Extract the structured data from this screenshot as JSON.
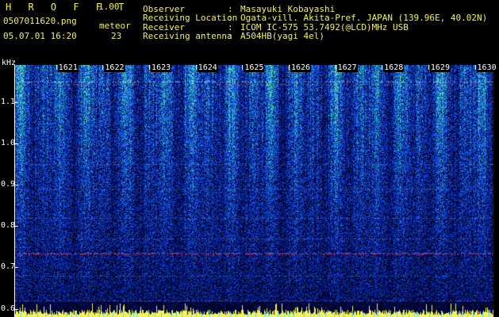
{
  "header": {
    "app_title": "H R O F F T",
    "version": "1.00",
    "filename": "0507011620.png",
    "meteor_label": "meteor",
    "datetime": "05.07.01 16:20",
    "meteor_count": "23",
    "info": [
      {
        "key": "Observer",
        "sep": ":",
        "value": "Masayuki Kobayashi"
      },
      {
        "key": "Receiving Location",
        "sep": ":",
        "value": "Ogata-vill. Akita-Pref. JAPAN (139.96E, 40.02N)"
      },
      {
        "key": "Receiver",
        "sep": ":",
        "value": "ICOM IC-575 53.7492(@LCD)MHz USB"
      },
      {
        "key": "Receiving antenna",
        "sep": ":",
        "value": "A504HB(yagi 4el)"
      }
    ]
  },
  "chart_data": {
    "type": "heatmap",
    "ylabel": "kHz",
    "yticks": [
      "1.1",
      "1.0",
      "0.9",
      "0.8",
      "0.7",
      "0.6"
    ],
    "ylim": [
      0.58,
      1.19
    ],
    "xticks": [
      "1621",
      "1622",
      "1623",
      "1624",
      "1625",
      "1626",
      "1627",
      "1628",
      "1629",
      "1630"
    ],
    "xlim": [
      1620.1,
      1630.4
    ],
    "colors": {
      "low": "#000a5a",
      "mid": "#1a5cff",
      "high": "#35e8a0",
      "peak": "#f4f45a",
      "carrier": "#ff5070"
    },
    "carrier_khz": 0.735
  }
}
